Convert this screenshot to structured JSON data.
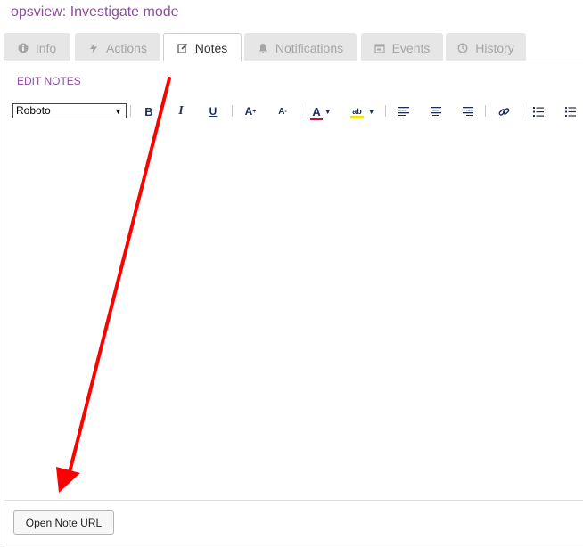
{
  "header": {
    "title": "opsview: Investigate mode"
  },
  "tabs": [
    {
      "label": "Info",
      "icon": "info-icon",
      "active": false
    },
    {
      "label": "Actions",
      "icon": "bolt-icon",
      "active": false
    },
    {
      "label": "Notes",
      "icon": "edit-icon",
      "active": true
    },
    {
      "label": "Notifications",
      "icon": "bell-icon",
      "active": false
    },
    {
      "label": "Events",
      "icon": "calendar-icon",
      "active": false
    },
    {
      "label": "History",
      "icon": "history-icon",
      "active": false
    }
  ],
  "editor": {
    "section_label": "EDIT NOTES",
    "font_value": "Roboto",
    "toolbar": {
      "bold": "B",
      "italic": "I",
      "underline": "U",
      "font_grow": "A",
      "font_shrink": "A",
      "font_color": "A",
      "highlight": "ab"
    }
  },
  "actions": {
    "open_note_url_label": "Open Note URL"
  },
  "colors": {
    "accent": "#8b4d9e",
    "toolbar_icon": "#1f2d5a",
    "font_color_bar": "#c0143c",
    "highlight_bar": "#f2e600",
    "annotation_arrow": "#ff0000"
  }
}
